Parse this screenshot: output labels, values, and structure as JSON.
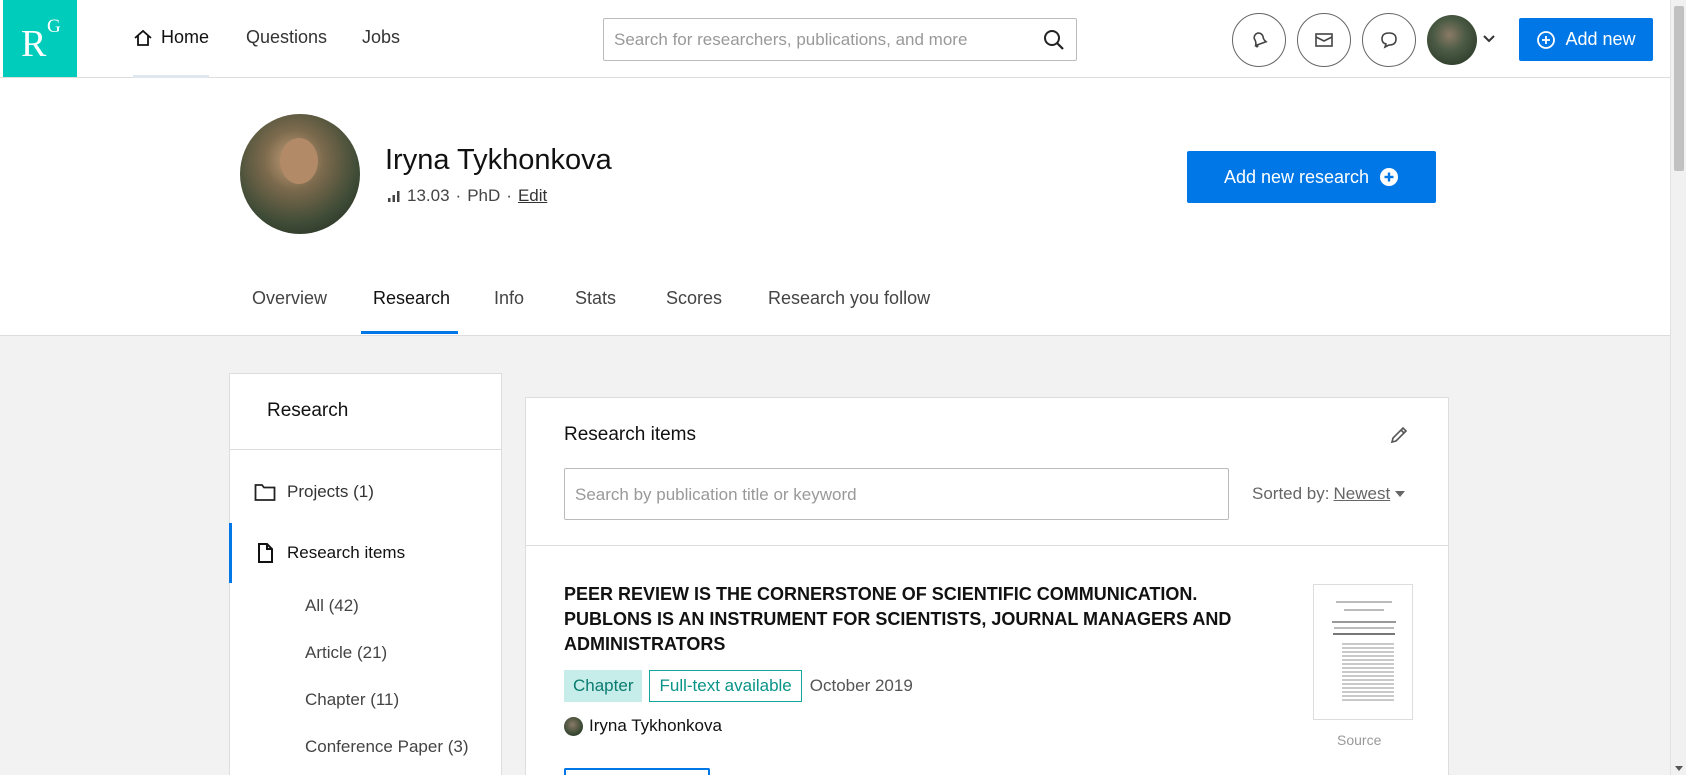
{
  "logo": {
    "letter": "R",
    "superscript": "G"
  },
  "nav": {
    "home": "Home",
    "questions": "Questions",
    "jobs": "Jobs",
    "search_placeholder": "Search for researchers, publications, and more",
    "add_new": "Add new"
  },
  "profile": {
    "name": "Iryna Tykhonkova",
    "score": "13.03",
    "degree": "PhD",
    "edit": "Edit",
    "add_research": "Add new research"
  },
  "tabs": [
    {
      "label": "Overview"
    },
    {
      "label": "Research"
    },
    {
      "label": "Info"
    },
    {
      "label": "Stats"
    },
    {
      "label": "Scores"
    },
    {
      "label": "Research you follow"
    }
  ],
  "sidebar": {
    "title": "Research",
    "projects": "Projects (1)",
    "research_items": "Research items",
    "subitems": [
      {
        "label": "All (42)"
      },
      {
        "label": "Article (21)"
      },
      {
        "label": "Chapter (11)"
      },
      {
        "label": "Conference Paper (3)"
      }
    ]
  },
  "main": {
    "title": "Research items",
    "search_placeholder": "Search by publication title or keyword",
    "sort_label": "Sorted by:",
    "sort_value": "Newest"
  },
  "publication": {
    "title": "PEER REVIEW IS THE CORNERSTONE OF SCIENTIFIC COMMUNICATION. PUBLONS IS AN INSTRUMENT FOR SCIENTISTS, JOURNAL MANAGERS AND ADMINISTRATORS",
    "type": "Chapter",
    "availability": "Full-text available",
    "date": "October 2019",
    "author": "Iryna Tykhonkova",
    "thumb_caption": "Source"
  },
  "colors": {
    "brand": "#00ccbb",
    "primary": "#0077e6",
    "tag_bg": "#c6ede9",
    "tag_text": "#0a7b71"
  }
}
